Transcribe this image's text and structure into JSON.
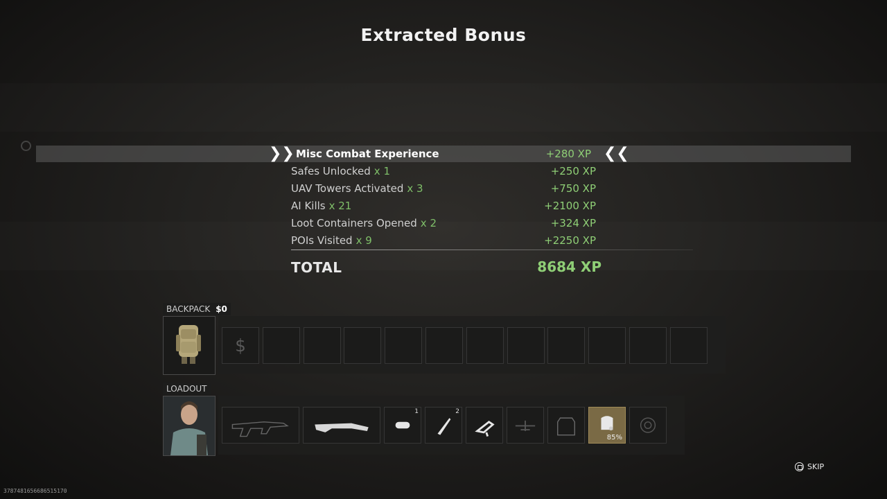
{
  "title": "Extracted Bonus",
  "timer": {
    "icon": "clock-icon",
    "text": ""
  },
  "bonus_rows": [
    {
      "label": "Misc Combat Experience",
      "multiplier": "",
      "xp": "+280 XP",
      "highlighted": true
    },
    {
      "label": "Safes Unlocked",
      "multiplier": "x 1",
      "xp": "+250 XP"
    },
    {
      "label": "UAV Towers Activated",
      "multiplier": "x 3",
      "xp": "+750 XP"
    },
    {
      "label": "AI Kills",
      "multiplier": "x 21",
      "xp": "+2100 XP"
    },
    {
      "label": "Loot Containers Opened",
      "multiplier": "x 2",
      "xp": "+324 XP"
    },
    {
      "label": "POIs Visited",
      "multiplier": "x 9",
      "xp": "+2250 XP"
    }
  ],
  "total": {
    "label": "TOTAL",
    "value": "8684 XP"
  },
  "backpack": {
    "label": "BACKPACK",
    "cash": "$0",
    "slots": [
      "cash-icon",
      "",
      "",
      "",
      "",
      "",
      "",
      "",
      "",
      "",
      "",
      ""
    ]
  },
  "loadout": {
    "label": "LOADOUT",
    "slots": [
      {
        "icon": "assault-rifle-icon",
        "count": ""
      },
      {
        "icon": "shotgun-icon",
        "count": ""
      },
      {
        "icon": "tactical-equipment-icon",
        "count": "1"
      },
      {
        "icon": "throwing-knife-icon",
        "count": "2"
      },
      {
        "icon": "field-upgrade-icon",
        "count": ""
      },
      {
        "icon": "killstreak-icon",
        "count": ""
      },
      {
        "icon": "armor-plate-icon",
        "count": ""
      },
      {
        "icon": "armor-vest-icon",
        "count": "",
        "percent": "85%",
        "value": 0.85
      },
      {
        "icon": "gas-mask-icon",
        "count": ""
      }
    ]
  },
  "skip": {
    "label": "SKIP",
    "icon": "square-button-icon"
  },
  "footer_id": "3787481656686515170",
  "colors": {
    "xp_green": "#8fcf76",
    "multiplier_green": "#7fbf69",
    "armor_slot": "#7a6a45"
  }
}
